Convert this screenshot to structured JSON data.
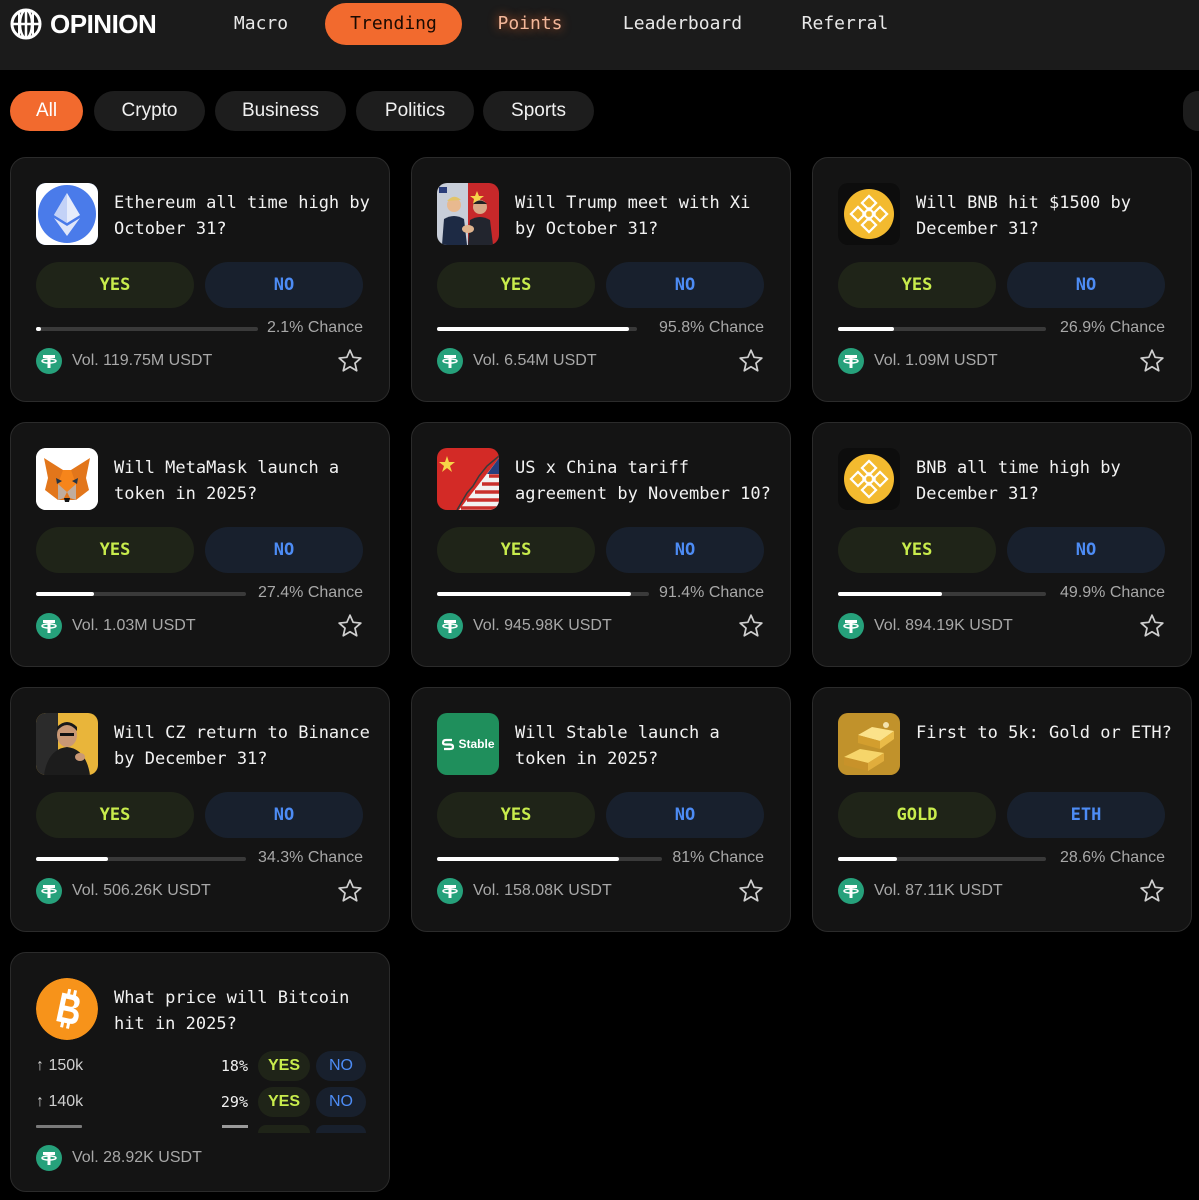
{
  "brand": {
    "name": "OPINION"
  },
  "nav": {
    "items": [
      {
        "label": "Macro"
      },
      {
        "label": "Trending"
      },
      {
        "label": "Points"
      },
      {
        "label": "Leaderboard"
      },
      {
        "label": "Referral"
      }
    ],
    "active": "Trending"
  },
  "categories": {
    "items": [
      {
        "label": "All"
      },
      {
        "label": "Crypto"
      },
      {
        "label": "Business"
      },
      {
        "label": "Politics"
      },
      {
        "label": "Sports"
      }
    ],
    "active": "All"
  },
  "markets": [
    {
      "title": "Ethereum all time high by October 31?",
      "icon": "ethereum-icon",
      "yes_label": "YES",
      "no_label": "NO",
      "chance": 2.1,
      "chance_text": "2.1% Chance",
      "volume": "Vol. 119.75M USDT"
    },
    {
      "title": "Will Trump meet with Xi by October 31?",
      "icon": "trump-xi-photo",
      "yes_label": "YES",
      "no_label": "NO",
      "chance": 95.8,
      "chance_text": "95.8% Chance",
      "volume": "Vol. 6.54M USDT"
    },
    {
      "title": "Will BNB hit $1500 by December 31?",
      "icon": "bnb-icon",
      "yes_label": "YES",
      "no_label": "NO",
      "chance": 26.9,
      "chance_text": "26.9% Chance",
      "volume": "Vol. 1.09M USDT"
    },
    {
      "title": "Will MetaMask launch a token in 2025?",
      "icon": "metamask-fox-icon",
      "yes_label": "YES",
      "no_label": "NO",
      "chance": 27.4,
      "chance_text": "27.4% Chance",
      "volume": "Vol. 1.03M USDT"
    },
    {
      "title": "US x China tariff agreement by November 10?",
      "icon": "us-china-flag-icon",
      "yes_label": "YES",
      "no_label": "NO",
      "chance": 91.4,
      "chance_text": "91.4% Chance",
      "volume": "Vol. 945.98K USDT"
    },
    {
      "title": "BNB all time high by December 31?",
      "icon": "bnb-icon",
      "yes_label": "YES",
      "no_label": "NO",
      "chance": 49.9,
      "chance_text": "49.9% Chance",
      "volume": "Vol. 894.19K USDT"
    },
    {
      "title": "Will CZ return to Binance by December 31?",
      "icon": "cz-photo",
      "yes_label": "YES",
      "no_label": "NO",
      "chance": 34.3,
      "chance_text": "34.3% Chance",
      "volume": "Vol. 506.26K USDT"
    },
    {
      "title": "Will Stable launch a token in 2025?",
      "icon": "stable-logo",
      "logo_text": "Stable",
      "yes_label": "YES",
      "no_label": "NO",
      "chance": 81,
      "chance_text": "81% Chance",
      "volume": "Vol. 158.08K USDT"
    },
    {
      "title": "First to 5k: Gold or ETH?",
      "icon": "gold-bars-icon",
      "yes_label": "GOLD",
      "no_label": "ETH",
      "chance": 28.6,
      "chance_text": "28.6% Chance",
      "volume": "Vol. 87.11K USDT"
    }
  ],
  "bitcoin": {
    "title": "What price will Bitcoin hit in 2025?",
    "icon": "bitcoin-icon",
    "rows": [
      {
        "label": "↑ 150k",
        "pct": "18%",
        "yes_label": "YES",
        "no_label": "NO"
      },
      {
        "label": "↑ 140k",
        "pct": "29%",
        "yes_label": "YES",
        "no_label": "NO"
      }
    ],
    "volume": "Vol. 28.92K USDT"
  },
  "colors": {
    "accent": "#f26a2e",
    "yes": "#c8ec4c",
    "no": "#4d8cf5",
    "tether": "#26a17b"
  }
}
